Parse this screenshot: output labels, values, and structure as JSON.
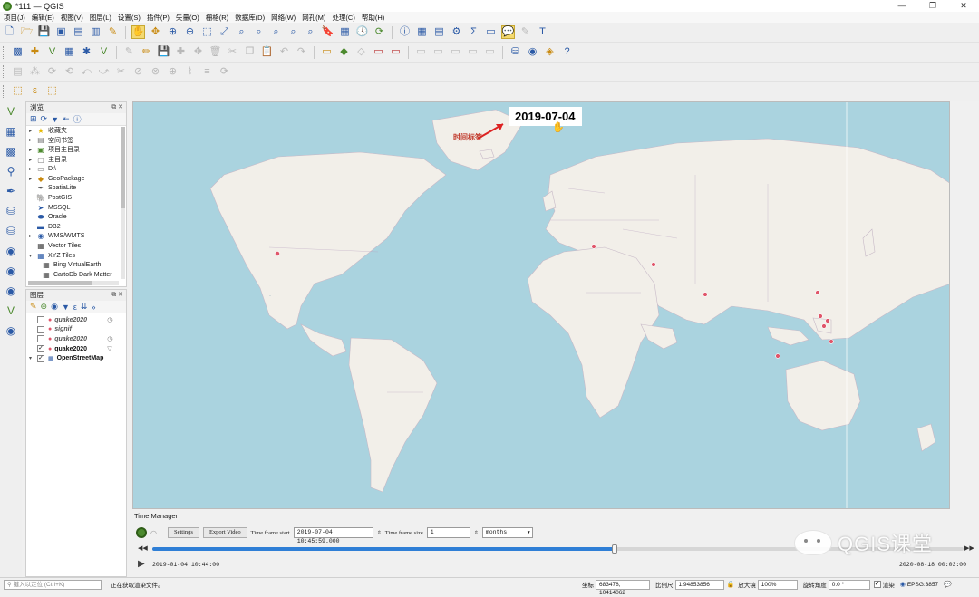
{
  "window": {
    "title": "*111 — QGIS",
    "controls": [
      "—",
      "❐",
      "✕"
    ]
  },
  "menubar": [
    "项目(J)",
    "编辑(E)",
    "视图(V)",
    "图层(L)",
    "设置(S)",
    "插件(P)",
    "矢量(O)",
    "栅格(R)",
    "数据库(D)",
    "网络(W)",
    "网孔(M)",
    "处理(C)",
    "帮助(H)"
  ],
  "browser_panel": {
    "title": "浏览",
    "items": [
      {
        "label": "收藏夹",
        "icon": "star-icon"
      },
      {
        "label": "空间书签",
        "icon": "bookmark-icon"
      },
      {
        "label": "项目主目录",
        "icon": "folder-icon"
      },
      {
        "label": "主目录",
        "icon": "home-folder-icon"
      },
      {
        "label": "D:\\",
        "icon": "drive-icon"
      },
      {
        "label": "GeoPackage",
        "icon": "geopackage-icon"
      },
      {
        "label": "SpatiaLite",
        "icon": "spatialite-icon"
      },
      {
        "label": "PostGIS",
        "icon": "postgis-icon"
      },
      {
        "label": "MSSQL",
        "icon": "mssql-icon"
      },
      {
        "label": "Oracle",
        "icon": "oracle-icon"
      },
      {
        "label": "DB2",
        "icon": "db2-icon"
      },
      {
        "label": "WMS/WMTS",
        "icon": "globe-icon"
      },
      {
        "label": "Vector Tiles",
        "icon": "grid-icon"
      },
      {
        "label": "XYZ Tiles",
        "icon": "grid-icon"
      },
      {
        "label": "Bing VirtualEarth",
        "icon": "tile-icon"
      },
      {
        "label": "CartoDb Dark Matter",
        "icon": "tile-icon"
      }
    ]
  },
  "layers_panel": {
    "title": "图层",
    "layers": [
      {
        "name": "quake2020",
        "checked": false,
        "style": "italic",
        "indicator": "clock-icon"
      },
      {
        "name": "signif",
        "checked": false,
        "style": "italic",
        "indicator": ""
      },
      {
        "name": "quake2020",
        "checked": false,
        "style": "italic",
        "indicator": "clock-icon"
      },
      {
        "name": "quake2020",
        "checked": true,
        "style": "bold",
        "indicator": "filter-icon"
      },
      {
        "name": "OpenStreetMap",
        "checked": true,
        "style": "bold",
        "indicator": ""
      }
    ]
  },
  "map": {
    "time_label": "2019-07-04",
    "annotation": "时间标签",
    "ocean_color": "#aad3df",
    "land_color": "#f2efe9",
    "point_color": "#e0566a"
  },
  "time_manager": {
    "title": "Time Manager",
    "settings_label": "Settings",
    "export_label": "Export Video",
    "frame_start_label": "Time frame start",
    "frame_start_value": "2019-07-04 10:45:59.000",
    "frame_size_label": "Time frame size",
    "frame_size_value": "1",
    "unit_value": "months",
    "start_time": "2019-01-04 10:44:00",
    "end_time": "2020-08-18 00:03:00",
    "progress": 0.57
  },
  "statusbar": {
    "locator_placeholder": "键入以定位 (Ctrl+K)",
    "message": "正在获取渲染文件。",
    "coord_label": "坐标",
    "coord_value": "683478, 10414062",
    "scale_label": "比例尺",
    "scale_value": "1:94853856",
    "magnifier_label": "放大镜",
    "magnifier_value": "100%",
    "rotation_label": "旋转角度",
    "rotation_value": "0.0 °",
    "render_label": "渲染",
    "crs_label": "EPSG:3857"
  },
  "watermark": "QGIS课堂"
}
